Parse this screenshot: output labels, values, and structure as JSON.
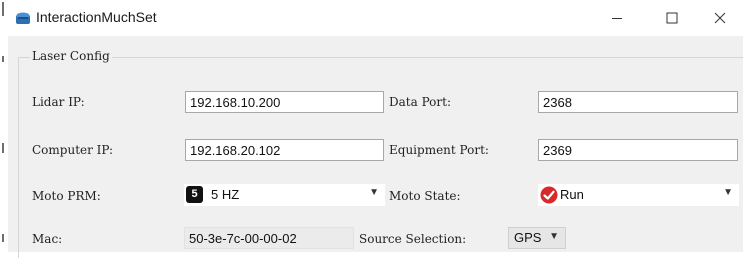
{
  "window": {
    "title": "InteractionMuchSet",
    "icons": {
      "app": "app-icon",
      "minimize": "minimize-icon",
      "maximize": "maximize-icon",
      "close": "close-icon"
    }
  },
  "group": {
    "title": "Laser Config"
  },
  "labels": {
    "lidar_ip": "Lidar IP:",
    "data_port": "Data Port:",
    "computer_ip": "Computer IP:",
    "equipment_port": "Equipment Port:",
    "moto_prm": "Moto PRM:",
    "moto_state": "Moto State:",
    "mac": "Mac:",
    "source_selection": "Source Selection:"
  },
  "values": {
    "lidar_ip": "192.168.10.200",
    "data_port": "2368",
    "computer_ip": "192.168.20.102",
    "equipment_port": "2369",
    "moto_prm": "5 HZ",
    "moto_prm_badge": "5",
    "moto_state": "Run",
    "mac": "50-3e-7c-00-00-02",
    "source_selection": "GPS"
  },
  "colors": {
    "run_icon": "#d62b2b",
    "badge": "#111111"
  }
}
